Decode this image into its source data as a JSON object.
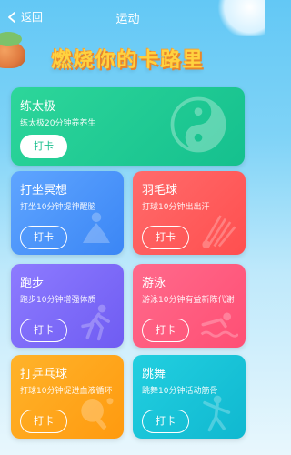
{
  "header": {
    "back_label": "返回",
    "title": "运动"
  },
  "banner": {
    "text": "燃烧你的卡路里"
  },
  "cards": [
    {
      "name": "练太极",
      "desc": "练太极20分钟养养生",
      "button": "打卡",
      "icon": "taiji-icon"
    },
    {
      "name": "打坐冥想",
      "desc": "打坐10分钟提神醒脑",
      "button": "打卡",
      "icon": "meditation-icon"
    },
    {
      "name": "羽毛球",
      "desc": "打球10分钟出出汗",
      "button": "打卡",
      "icon": "shuttlecock-icon"
    },
    {
      "name": "跑步",
      "desc": "跑步10分钟增强体质",
      "button": "打卡",
      "icon": "running-icon"
    },
    {
      "name": "游泳",
      "desc": "游泳10分钟有益新陈代谢",
      "button": "打卡",
      "icon": "swimming-icon"
    },
    {
      "name": "打乒乓球",
      "desc": "打球10分钟促进血液循环",
      "button": "打卡",
      "icon": "ping-pong-icon"
    },
    {
      "name": "跳舞",
      "desc": "跳舞10分钟活动筋骨",
      "button": "打卡",
      "icon": "dancing-icon"
    }
  ],
  "colors": {
    "taiji": "#15c08e",
    "meditation": "#3b86f5",
    "badminton": "#ff4f4f",
    "running": "#6f5cf2",
    "swimming": "#ff4f74",
    "pingpong": "#ff9a0f",
    "dancing": "#10b8d0",
    "banner": "#ffd23f"
  }
}
